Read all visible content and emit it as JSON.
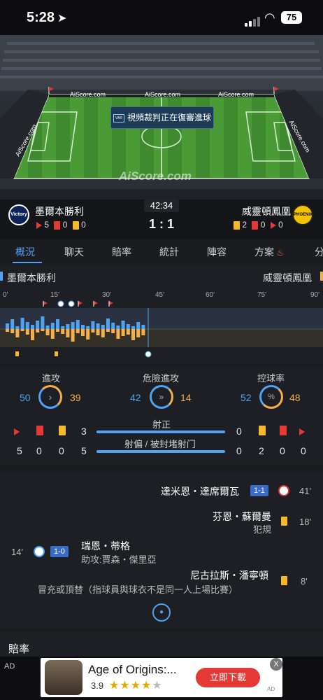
{
  "status": {
    "time": "5:28",
    "battery": "75"
  },
  "field": {
    "brand": "AiScore.com",
    "ads": [
      "AiScore.com",
      "AiScore.com",
      "AiScore.com",
      "AiScore.com",
      "AiScore.com"
    ],
    "replay_text": "視頻裁判正在復審進球",
    "tv_label": "VAR"
  },
  "match": {
    "clock": "42:34",
    "score": "1 : 1",
    "home": {
      "name": "墨爾本勝利",
      "logo_text": "Victory",
      "corners": "5",
      "red": "0",
      "yellow": "0"
    },
    "away": {
      "name": "威靈頓鳳凰",
      "logo_text": "PHOENIX",
      "corners": "0",
      "red": "0",
      "yellow": "2"
    }
  },
  "tabs": [
    "概況",
    "聊天",
    "賠率",
    "統計",
    "陣容",
    "方案",
    "分"
  ],
  "timeline": {
    "home": "墨爾本勝利",
    "away": "威靈頓鳳凰",
    "ticks": [
      "0'",
      "15'",
      "30'",
      "45'",
      "60'",
      "75'",
      "90'"
    ]
  },
  "stats": {
    "attack": {
      "label": "進攻",
      "home": "50",
      "away": "39"
    },
    "danger": {
      "label": "危險進攻",
      "home": "42",
      "away": "14"
    },
    "possession": {
      "label": "控球率",
      "home": "52",
      "away": "48",
      "icon_text": "%"
    },
    "shots_on": {
      "label": "射正",
      "home": "3",
      "away": "0"
    },
    "shots_off": {
      "label": "射偏 / 被封堵射门",
      "home": "5",
      "away": "2"
    },
    "home_row": {
      "corners": "5",
      "red": "0",
      "yellow": "0",
      "off": "5"
    },
    "away_row": {
      "off": "0",
      "yellow": "2",
      "red": "0",
      "corners": "0"
    }
  },
  "events": [
    {
      "side": "away",
      "player": "達米恩・達席爾瓦",
      "badge": "1-1",
      "minute": "41'"
    },
    {
      "side": "away",
      "player": "芬恩・蘇爾曼",
      "detail": "犯規",
      "minute": "18'"
    },
    {
      "side": "home",
      "player": "瑞恩・蒂格",
      "assist": "助攻:賈森・傑里亞",
      "badge": "1-0",
      "minute": "14'"
    },
    {
      "side": "away",
      "player": "尼古拉斯・潘寧頓",
      "detail": "冒充或頂替（指球員與球衣不是同一人上場比賽）",
      "minute": "8'"
    }
  ],
  "odds_title": "賠率",
  "ad": {
    "label": "AD",
    "title": "Age of Origins:...",
    "rating": "3.9",
    "stars": 4,
    "button": "立即下載",
    "close": "X",
    "tag": "AD"
  }
}
